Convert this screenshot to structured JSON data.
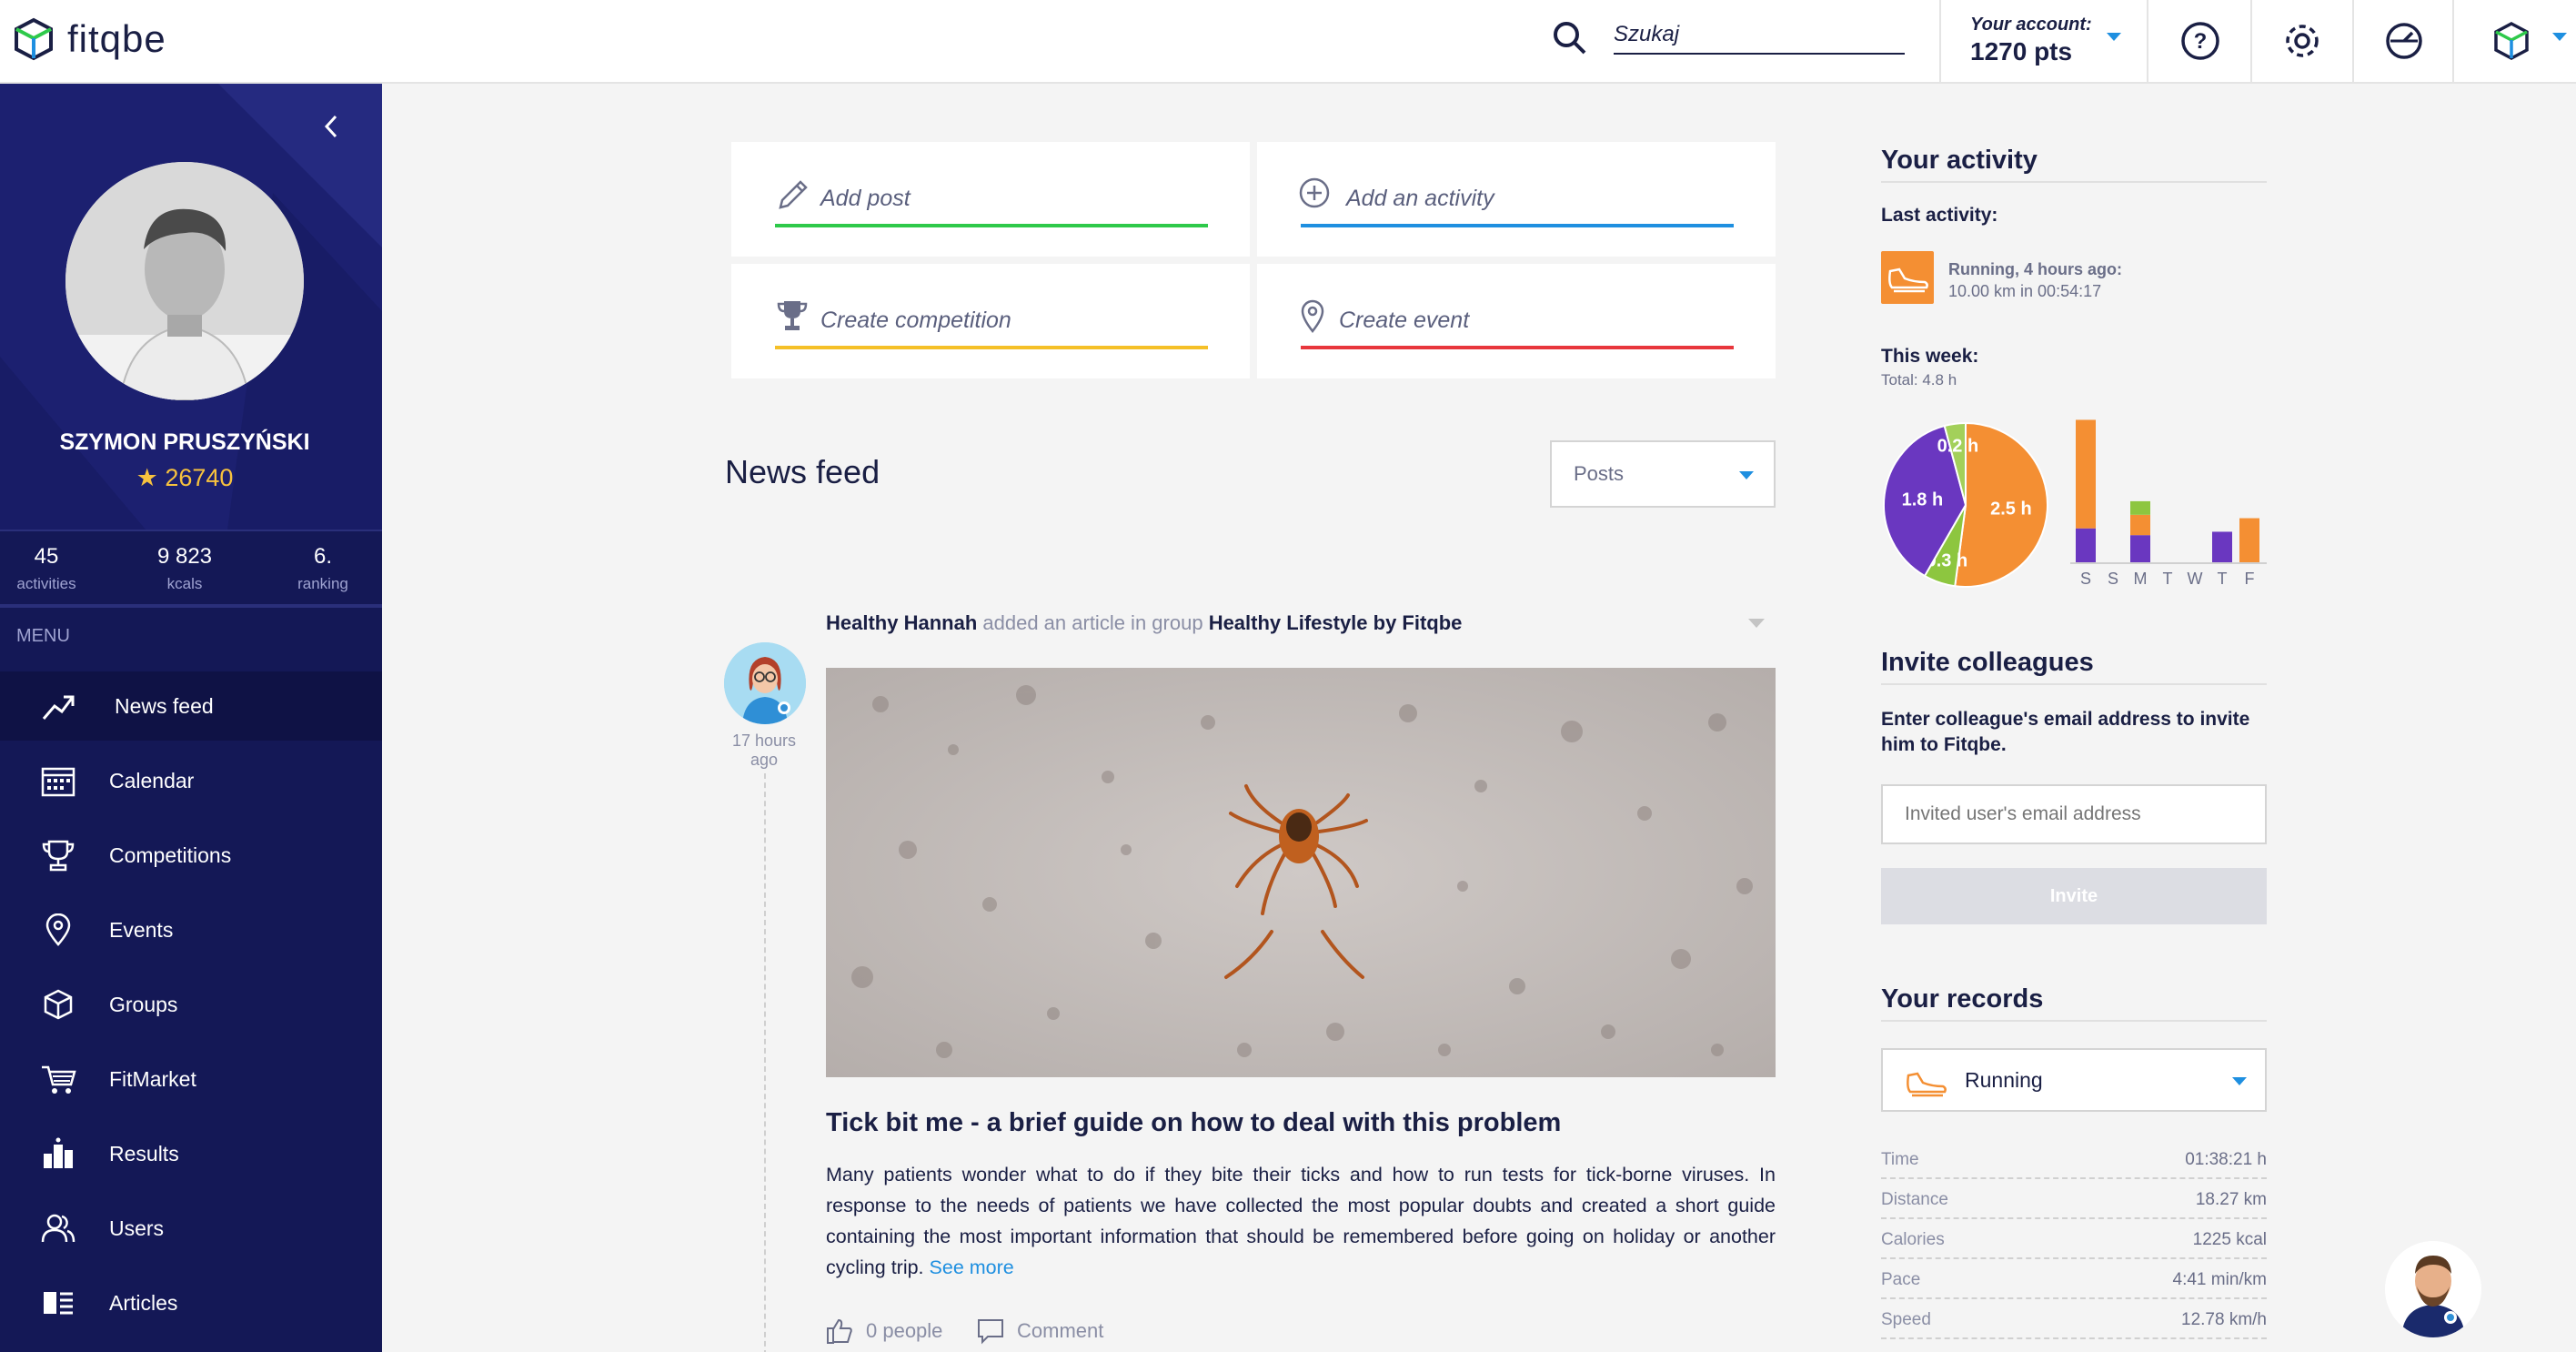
{
  "header": {
    "logo_text": "fitqbe",
    "search_placeholder": "Szukaj",
    "account_label": "Your account:",
    "account_points": "1270 pts",
    "icons": [
      "help-icon",
      "settings-icon",
      "dashboard-icon",
      "fitqbe-cube-icon"
    ]
  },
  "sidebar": {
    "user_name": "SZYMON PRUSZYŃSKI",
    "points": "26740",
    "stats": [
      {
        "value": "45",
        "label": "activities"
      },
      {
        "value": "9 823",
        "label": "kcals"
      },
      {
        "value": "6.",
        "label": "ranking"
      }
    ],
    "menu_title": "MENU",
    "menu": [
      {
        "label": "News feed",
        "icon": "trending-icon",
        "active": true
      },
      {
        "label": "Calendar",
        "icon": "calendar-icon"
      },
      {
        "label": "Competitions",
        "icon": "trophy-icon"
      },
      {
        "label": "Events",
        "icon": "location-pin-icon"
      },
      {
        "label": "Groups",
        "icon": "groups-icon"
      },
      {
        "label": "FitMarket",
        "icon": "cart-icon"
      },
      {
        "label": "Results",
        "icon": "results-icon"
      },
      {
        "label": "Users",
        "icon": "users-icon"
      },
      {
        "label": "Articles",
        "icon": "articles-icon"
      }
    ]
  },
  "actions": [
    {
      "label": "Add post",
      "color": "#2ec94a",
      "icon": "pencil-icon"
    },
    {
      "label": "Add an activity",
      "color": "#1e8fe0",
      "icon": "plus-circle-icon"
    },
    {
      "label": "Create competition",
      "color": "#f5c028",
      "icon": "trophy-icon"
    },
    {
      "label": "Create event",
      "color": "#e8363c",
      "icon": "location-pin-icon"
    }
  ],
  "feed": {
    "title": "News feed",
    "filter_value": "Posts",
    "post": {
      "author": "Healthy Hannah",
      "action": "added an article in group",
      "group": "Healthy Lifestyle by Fitqbe",
      "time_line1": "17 hours",
      "time_line2": "ago",
      "title": "Tick bit me - a brief guide on how to deal with this problem",
      "body": "Many patients wonder what to do if they bite their ticks and how to run tests for tick-borne viruses. In response to the needs of patients we have collected the most popular doubts and created a short guide containing the most important information that should be remembered before going on holiday or another cycling trip.",
      "see_more": "See more",
      "likes": "0 people",
      "comment": "Comment"
    }
  },
  "activity": {
    "title": "Your activity",
    "last_label": "Last activity:",
    "last_line1": "Running, 4 hours ago:",
    "last_line2": "10.00 km in 00:54:17",
    "week_label": "This week:",
    "week_total": "Total: 4.8 h"
  },
  "chart_data": [
    {
      "type": "pie",
      "labels": [
        "2.5 h",
        "0.3 h",
        "1.8 h",
        "0.2 h"
      ],
      "values": [
        2.5,
        0.3,
        1.8,
        0.2
      ],
      "colors": [
        "#f48f33",
        "#8dc63f",
        "#6a37c0",
        "#a3d05a"
      ]
    },
    {
      "type": "bar",
      "stacked": true,
      "categories": [
        "S",
        "S",
        "M",
        "T",
        "W",
        "T",
        "F"
      ],
      "series": [
        {
          "values": [
            0.5,
            0,
            0.4,
            0,
            0,
            0.45,
            0
          ],
          "color": "#6a37c0"
        },
        {
          "values": [
            1.6,
            0,
            0.3,
            0,
            0,
            0,
            0.65
          ],
          "color": "#f48f33"
        },
        {
          "values": [
            0,
            0,
            0.2,
            0,
            0,
            0,
            0
          ],
          "color": "#8dc63f"
        }
      ],
      "ylim": [
        0,
        2.2
      ]
    }
  ],
  "invite": {
    "title": "Invite colleagues",
    "text": "Enter colleague's email address to invite him to Fitqbe.",
    "placeholder": "Invited user's email address",
    "button": "Invite"
  },
  "records": {
    "title": "Your records",
    "sport": "Running",
    "rows": [
      {
        "label": "Time",
        "value": "01:38:21 h"
      },
      {
        "label": "Distance",
        "value": "18.27 km"
      },
      {
        "label": "Calories",
        "value": "1225 kcal"
      },
      {
        "label": "Pace",
        "value": "4:41 min/km"
      },
      {
        "label": "Speed",
        "value": "12.78 km/h"
      }
    ]
  }
}
